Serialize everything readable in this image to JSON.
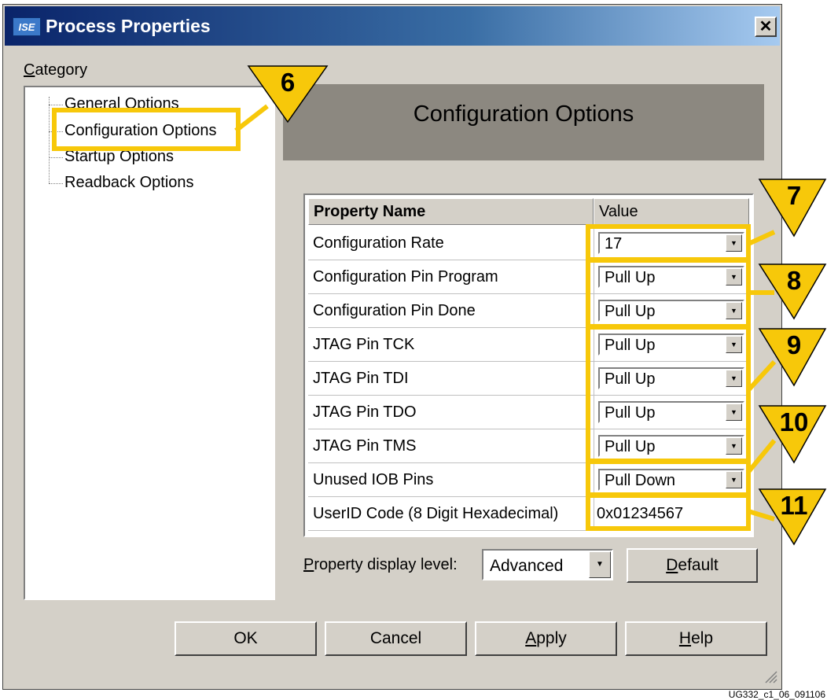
{
  "window": {
    "title": "Process Properties",
    "icon_text": "ISE",
    "close_glyph": "✕"
  },
  "category": {
    "label_prefix": "C",
    "label_rest": "ategory",
    "items": [
      {
        "label": "General Options"
      },
      {
        "label": "Configuration Options",
        "selected": true
      },
      {
        "label": "Startup Options"
      },
      {
        "label": "Readback Options"
      }
    ]
  },
  "panel": {
    "header": "Configuration Options"
  },
  "grid": {
    "columns": [
      "Property Name",
      "Value"
    ],
    "rows": [
      {
        "name": "Configuration Rate",
        "value": "17",
        "control": "dropdown"
      },
      {
        "name": "Configuration Pin Program",
        "value": "Pull Up",
        "control": "dropdown"
      },
      {
        "name": "Configuration Pin Done",
        "value": "Pull Up",
        "control": "dropdown"
      },
      {
        "name": "JTAG Pin TCK",
        "value": "Pull Up",
        "control": "dropdown"
      },
      {
        "name": "JTAG Pin TDI",
        "value": "Pull Up",
        "control": "dropdown"
      },
      {
        "name": "JTAG Pin TDO",
        "value": "Pull Up",
        "control": "dropdown"
      },
      {
        "name": "JTAG Pin TMS",
        "value": "Pull Up",
        "control": "dropdown"
      },
      {
        "name": "Unused IOB Pins",
        "value": "Pull Down",
        "control": "dropdown"
      },
      {
        "name": "UserID Code (8 Digit Hexadecimal)",
        "value": "0x01234567",
        "control": "text"
      }
    ]
  },
  "display_level": {
    "label_prefix": "P",
    "label_rest": "roperty display level:",
    "value": "Advanced",
    "default_prefix": "D",
    "default_rest": "efault"
  },
  "buttons": {
    "ok": "OK",
    "cancel": "Cancel",
    "apply_prefix": "A",
    "apply_rest": "pply",
    "help_prefix": "H",
    "help_rest": "elp"
  },
  "callouts": [
    "6",
    "7",
    "8",
    "9",
    "10",
    "11"
  ],
  "highlight_color": "#f7c80a",
  "footnote": "UG332_c1_06_091106"
}
